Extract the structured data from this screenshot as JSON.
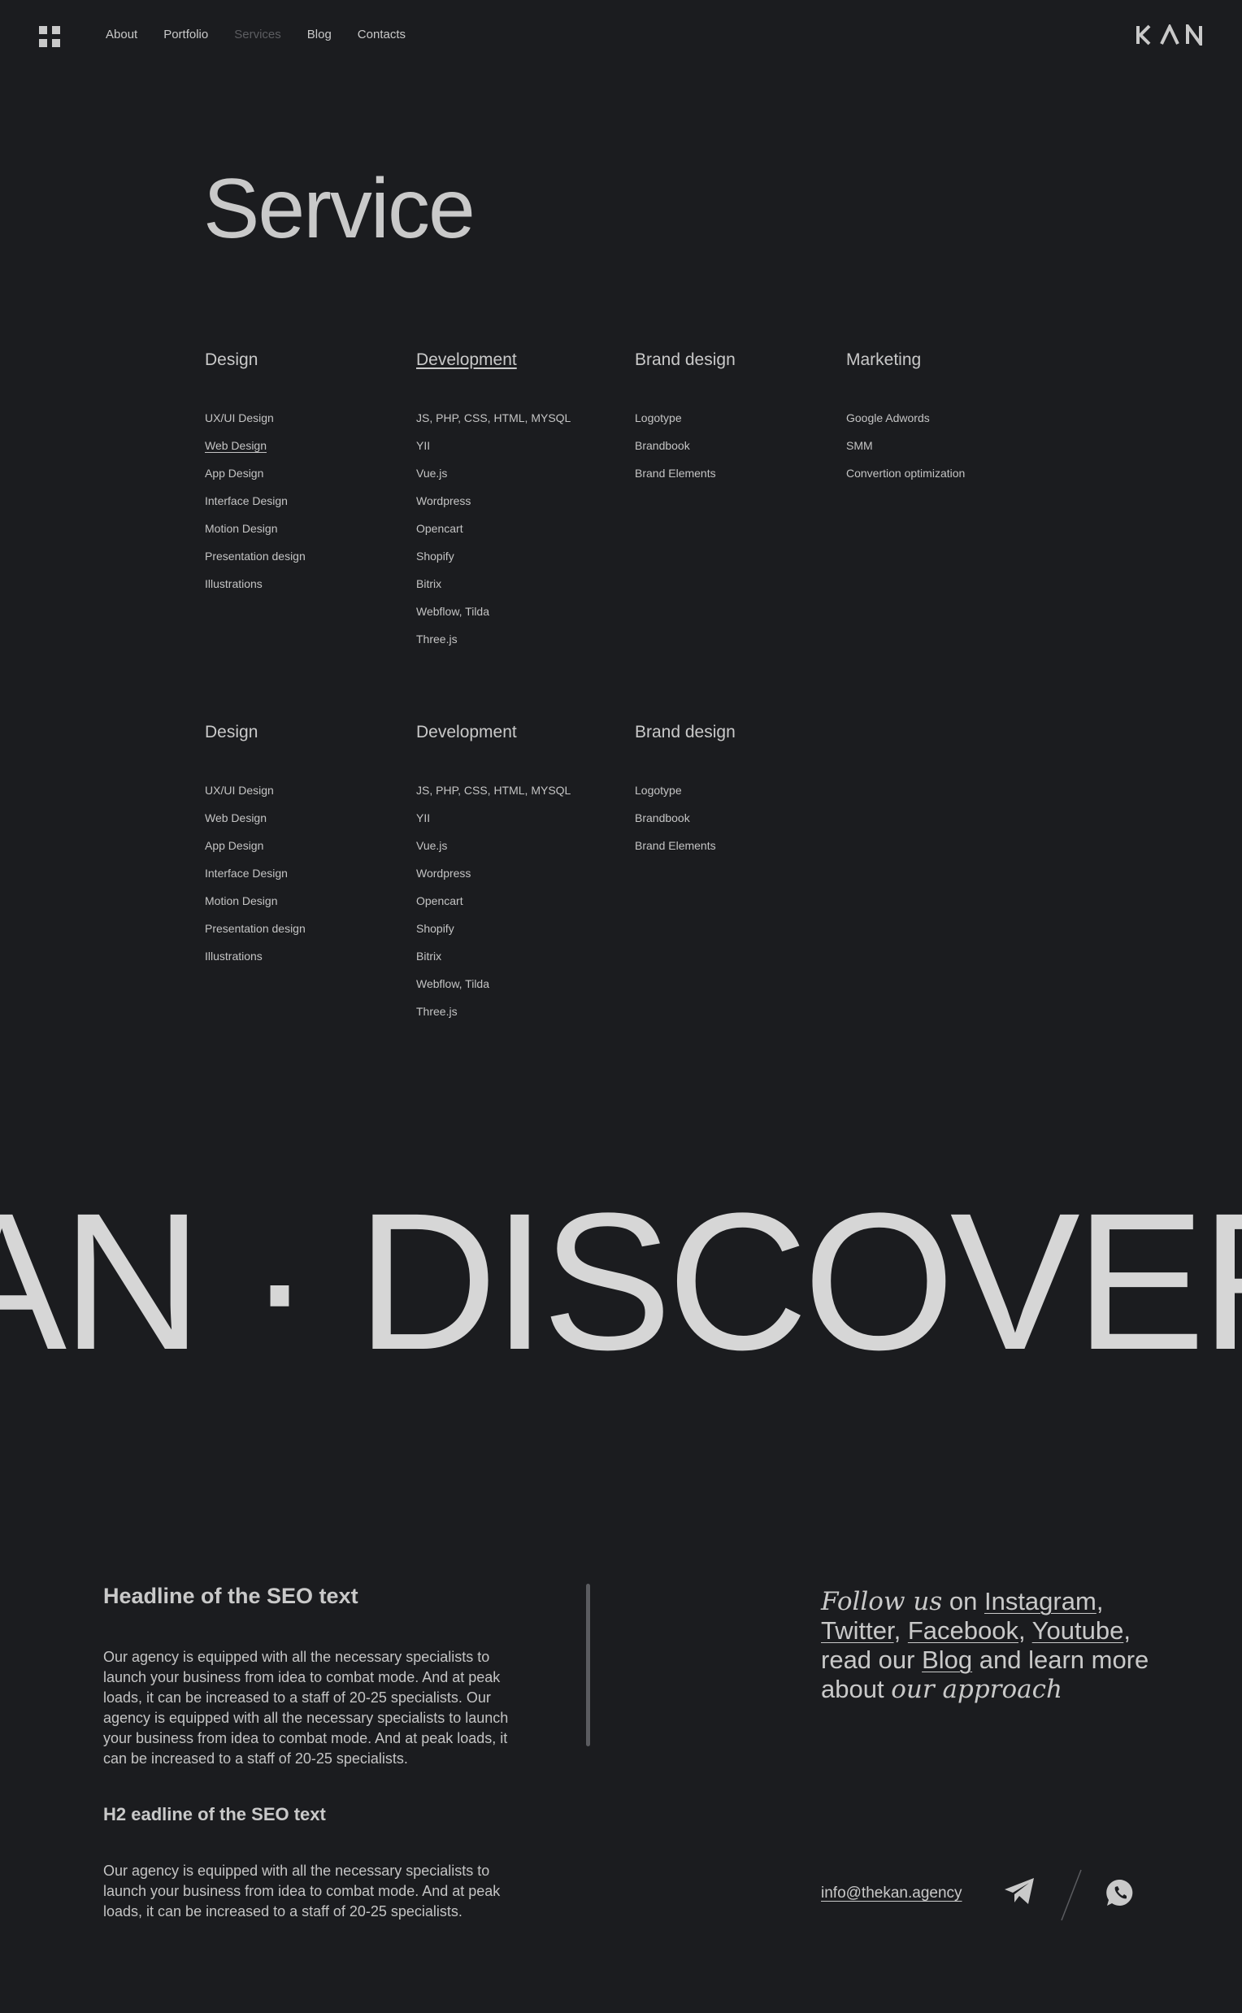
{
  "nav": {
    "links": [
      "About",
      "Portfolio",
      "Services",
      "Blog",
      "Contacts"
    ],
    "active": "Services",
    "logo": "KAN"
  },
  "page": {
    "title": "Service"
  },
  "sections": [
    {
      "columns": [
        {
          "title": "Design",
          "title_underlined": false,
          "items": [
            "UX/UI Design",
            "Web Design",
            "App Design",
            "Interface Design",
            "Motion Design",
            "Presentation design",
            "Illustrations"
          ],
          "underlined_item": "Web Design"
        },
        {
          "title": "Development",
          "title_underlined": true,
          "items": [
            "JS, PHP, CSS, HTML, MYSQL",
            "YII",
            "Vue.js",
            "Wordpress",
            "Opencart",
            "Shopify",
            "Bitrix",
            "Webflow, Tilda",
            "Three.js"
          ]
        },
        {
          "title": "Brand design",
          "title_underlined": false,
          "items": [
            "Logotype",
            "Brandbook",
            "Brand Elements"
          ]
        },
        {
          "title": "Marketing",
          "title_underlined": false,
          "items": [
            "Google Adwords",
            "SMM",
            "Convertion optimization"
          ]
        }
      ]
    },
    {
      "columns": [
        {
          "title": "Design",
          "title_underlined": false,
          "items": [
            "UX/UI Design",
            "Web Design",
            "App Design",
            "Interface Design",
            "Motion Design",
            "Presentation design",
            "Illustrations"
          ]
        },
        {
          "title": "Development",
          "title_underlined": false,
          "items": [
            "JS, PHP, CSS, HTML, MYSQL",
            "YII",
            "Vue.js",
            "Wordpress",
            "Opencart",
            "Shopify",
            "Bitrix",
            "Webflow, Tilda",
            "Three.js"
          ]
        },
        {
          "title": "Brand design",
          "title_underlined": false,
          "items": [
            "Logotype",
            "Brandbook",
            "Brand Elements"
          ]
        }
      ]
    }
  ],
  "marquee": {
    "text": "AN · DISCOVER"
  },
  "seo": {
    "headline": "Headline of the SEO text",
    "paragraph1": "Our agency is equipped with all the necessary specialists to launch your business from idea to combat mode. And at peak loads, it can be increased to a staff of 20-25 specialists. Our agency is equipped with all the necessary specialists to launch your business from idea to combat mode. And at peak loads, it can be increased to a staff of 20-25 specialists.",
    "h2": "H2 eadline of the SEO text",
    "paragraph2": "Our agency is equipped with all the necessary specialists to launch your business from idea to combat mode. And at peak loads, it can be increased to a staff of 20-25 specialists."
  },
  "follow": {
    "follow_us": "Follow us",
    "on": "on",
    "instagram": "Instagram",
    "twitter": "Twitter",
    "facebook": "Facebook",
    "youtube": "Youtube",
    "read_our": "read our",
    "blog": "Blog",
    "learn_more": "and learn more",
    "about": "about",
    "our_approach": "our approach",
    "comma": ","
  },
  "contact": {
    "email": "info@thekan.agency",
    "icons": [
      "telegram-icon",
      "whatsapp-icon"
    ]
  },
  "colors": {
    "background": "#1b1c1f",
    "text": "#c9c9c9",
    "nav_active": "#5c5d61",
    "marquee": "#d6d6d6"
  }
}
